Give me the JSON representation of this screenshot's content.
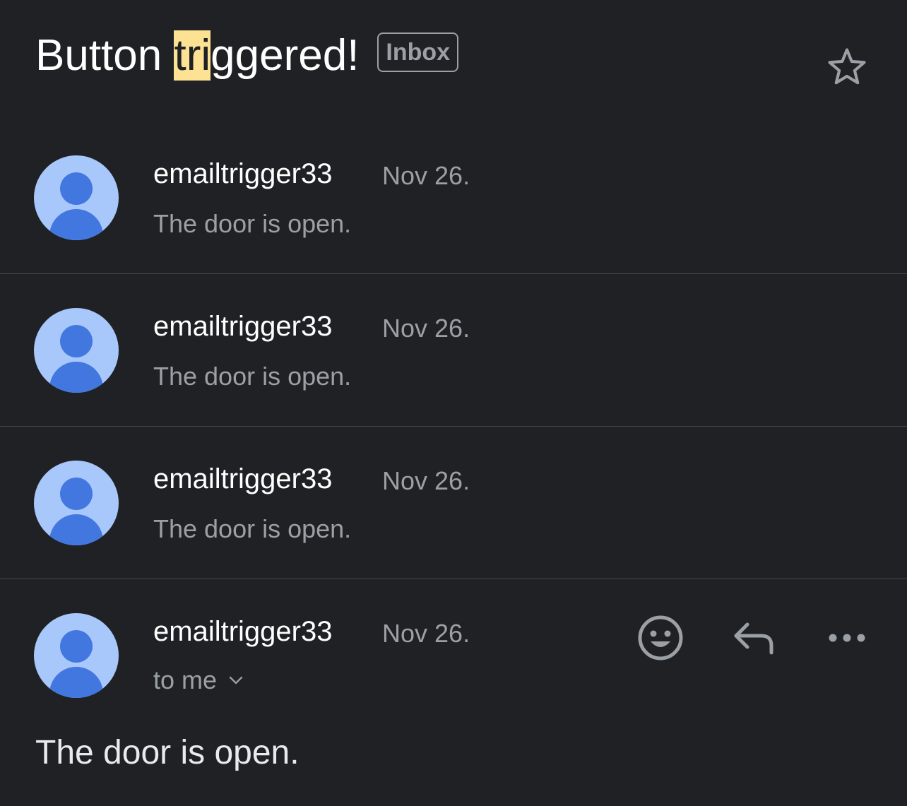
{
  "thread": {
    "subject_before": "Button ",
    "subject_highlight": "tri",
    "subject_after": "ggered!",
    "label": "Inbox",
    "star_icon": "star-outline-icon"
  },
  "messages": [
    {
      "sender": "emailtrigger33",
      "date": "Nov 26.",
      "snippet": "The door is open."
    },
    {
      "sender": "emailtrigger33",
      "date": "Nov 26.",
      "snippet": "The door is open."
    },
    {
      "sender": "emailtrigger33",
      "date": "Nov 26.",
      "snippet": "The door is open."
    }
  ],
  "expanded": {
    "sender": "emailtrigger33",
    "date": "Nov 26.",
    "recipient": "to me",
    "body": "The door is open.",
    "actions": [
      "emoji-reaction-icon",
      "reply-icon",
      "more-options-icon"
    ]
  },
  "colors": {
    "background": "#202124",
    "highlight": "#fde293",
    "avatar_bg": "#a8c7fa",
    "avatar_fg": "#4377e0",
    "secondary_text": "#9aa0a6"
  }
}
